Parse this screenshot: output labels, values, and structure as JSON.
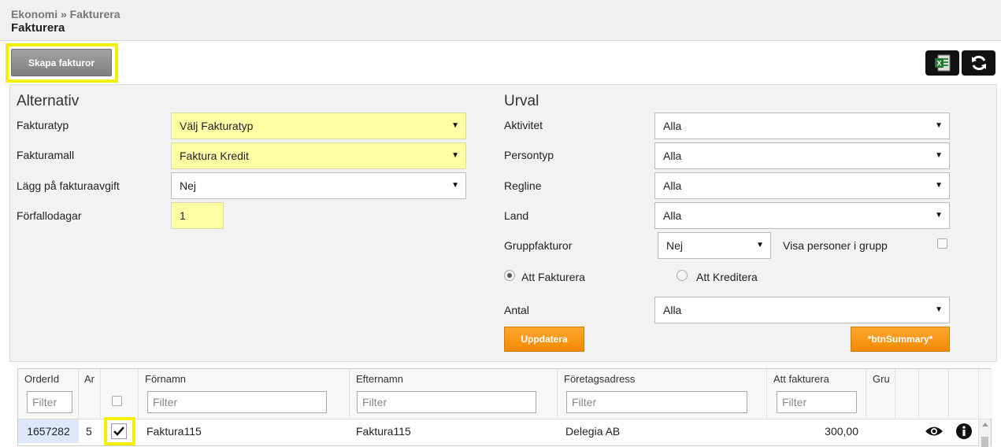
{
  "header": {
    "breadcrumb": "Ekonomi » Fakturera",
    "title": "Fakturera"
  },
  "toolbar": {
    "create_label": "Skapa fakturor"
  },
  "alternativ": {
    "title": "Alternativ",
    "fakturatyp_label": "Fakturatyp",
    "fakturatyp_value": "Välj Fakturatyp",
    "fakturamall_label": "Fakturamall",
    "fakturamall_value": "Faktura Kredit",
    "avgift_label": "Lägg på fakturaavgift",
    "avgift_value": "Nej",
    "forfallo_label": "Förfallodagar",
    "forfallo_value": "1"
  },
  "urval": {
    "title": "Urval",
    "aktivitet_label": "Aktivitet",
    "aktivitet_value": "Alla",
    "persontyp_label": "Persontyp",
    "persontyp_value": "Alla",
    "regline_label": "Regline",
    "regline_value": "Alla",
    "land_label": "Land",
    "land_value": "Alla",
    "grupp_label": "Gruppfakturor",
    "grupp_value": "Nej",
    "visa_label": "Visa personer i grupp",
    "radio_fakturera": "Att Fakturera",
    "radio_kreditera": "Att Kreditera",
    "antal_label": "Antal",
    "antal_value": "Alla",
    "update_label": "Uppdatera",
    "summary_label": "*btnSummary*"
  },
  "grid": {
    "columns": [
      "OrderId",
      "Ar",
      "",
      "Förnamn",
      "Efternamn",
      "Företagsadress",
      "Att fakturera",
      "Gru"
    ],
    "filter_placeholder": "Filter",
    "row": {
      "orderid": "1657282",
      "ar": "5",
      "fornamn": "Faktura115",
      "efternamn": "Faktura115",
      "adress": "Delegia AB",
      "att_fakturera": "300,00"
    }
  },
  "colors": {
    "highlight": "#f5f000",
    "orange": "#f28a00",
    "yellow_field": "#ffffa6"
  }
}
